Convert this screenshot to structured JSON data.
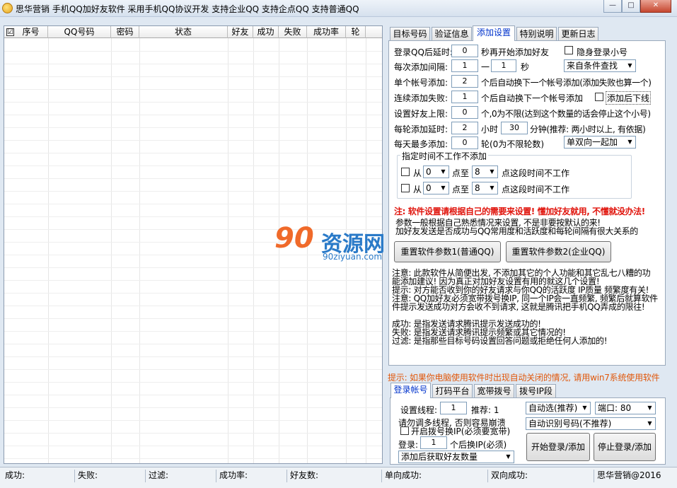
{
  "titlebar": {
    "title": "思华营销  手机QQ加好友软件   采用手机QQ协议开发  支持企业QQ  支持企点QQ  支持普通QQ",
    "minimize": "—",
    "maximize": "□",
    "close": "✕"
  },
  "grid": {
    "columns": [
      "序号",
      "QQ号码",
      "密码",
      "状态",
      "好友",
      "成功",
      "失败",
      "成功率",
      "轮"
    ],
    "header_checkbox": "☑"
  },
  "tabs": [
    "目标号码",
    "验证信息",
    "添加设置",
    "特别说明",
    "更新日志"
  ],
  "settings": {
    "login_delay_label": "登录QQ后延时:",
    "login_delay_value": "0",
    "login_delay_suffix": "秒再开始添加好友",
    "hidden_login_label": "隐身登录小号",
    "interval_label": "每次添加间隔:",
    "interval_from": "1",
    "interval_dash": "一",
    "interval_to": "1",
    "interval_unit": "秒",
    "source_select": "来自条件查找",
    "single_label": "单个帐号添加:",
    "single_value": "2",
    "single_suffix": "个后自动换下一个帐号添加(添加失败也算一个)",
    "consecutive_label": "连续添加失败:",
    "consecutive_value": "1",
    "consecutive_suffix": "个后自动换下一个帐号添加",
    "offline_after_label": "添加后下线",
    "limit_label": "设置好友上限:",
    "limit_value": "0",
    "limit_suffix": "个,0为不限(达到这个数量的话会停止这个小号)",
    "round_delay_label": "每轮添加延时:",
    "round_hours": "2",
    "round_hours_unit": "小时",
    "round_minutes": "30",
    "round_minutes_suffix": "分钟(推荐: 两小时以上, 有依据)",
    "daily_max_label": "每天最多添加:",
    "daily_max_value": "0",
    "daily_max_suffix": "轮(0为不限轮数)",
    "direction_select": "单双向一起加",
    "time_group_title": "指定时间不工作不添加",
    "time_from_label": "从",
    "time_to_label": "点至",
    "time_suffix": "点这段时间不工作",
    "time1_from": "0",
    "time1_to": "8",
    "time2_from": "0",
    "time2_to": "8",
    "warning": "注: 软件设置请根据自己的需要来设置! 懂加好友就用, 不懂就没办法!",
    "note1": "参数一般根据自己熟悉情况来设置, 不是非要按默认的来!",
    "note2": "加好友发送是否成功与QQ常用度和活跃度和每轮间隔有很大关系的",
    "reset1": "重置软件参数1(普通QQ)",
    "reset2": "重置软件参数2(企业QQ)",
    "notes": [
      "注意: 此款软件从简便出发, 不添加其它的个人功能和其它乱七八糟的功",
      "能添加建议! 因为真正对加好友设置有用的就这几个设置!",
      "提示: 对方能否收到你的好友请求与你QQ的活跃度 IP质量 频繁度有关!",
      "注意: QQ加好友必须宽带拨号换IP, 同一个IP会一直频繁, 频繁后就算软件",
      "件提示发送成功对方会收不到请求, 这就是腾讯把手机QQ弄成的限往!",
      "",
      "成功: 是指发送请求腾讯提示发送成功的!",
      "失败: 是指发送请求腾讯提示频繁或其它情况的!",
      "过滤: 是指那些目标号码设置回答问题或拒绝任何人添加的!"
    ]
  },
  "watermark": {
    "number": "90",
    "name": "资源网",
    "url": "90ziyuan.com"
  },
  "hint": "提示: 如果你电脑使用软件时出现自动关闭的情况, 请用win7系统使用软件",
  "tabs2": [
    "登录帐号",
    "打码平台",
    "宽带拨号",
    "拨号IP段"
  ],
  "login": {
    "threads_label": "设置线程:",
    "threads_value": "1",
    "recommend": "推荐: 1",
    "auto_select": "自动选(推荐)",
    "port_select": "端口: 80",
    "warn_text": "请勿调多线程, 否则容易崩溃",
    "auto_detect_select": "自动识别号码(不推荐)",
    "dial_ip_label": "开启拨号换IP(必须要宽带)",
    "login_label": "登录:",
    "login_value": "1",
    "login_suffix": "个后换IP(必须)",
    "after_add_select": "添加后获取好友数量",
    "start_button": "开始登录/添加",
    "stop_button": "停止登录/添加"
  },
  "status": {
    "success": "成功:",
    "fail": "失败:",
    "filter": "过滤:",
    "rate": "成功率:",
    "friends": "好友数:",
    "one_way": "单向成功:",
    "two_way": "双向成功:",
    "copyright": "思华营销@2016"
  }
}
